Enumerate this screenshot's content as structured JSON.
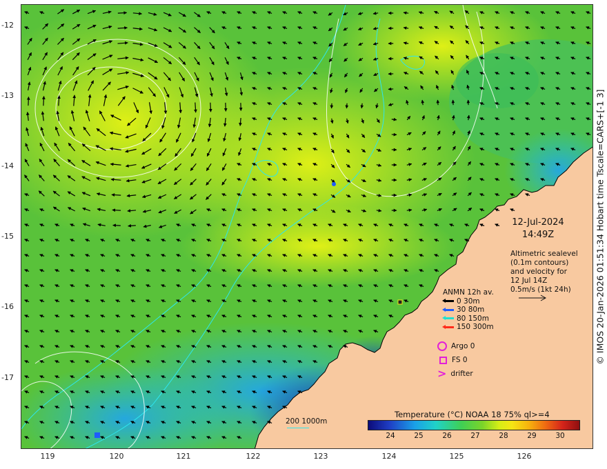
{
  "map": {
    "lat_labels": [
      "-12",
      "-13",
      "-14",
      "-15",
      "-16",
      "-17"
    ],
    "lon_labels": [
      "119",
      "120",
      "121",
      "122",
      "123",
      "124",
      "125",
      "126"
    ],
    "credit": "© IMOS 20-Jan-2026 01:51:34 Hobart time Tscale=CARS+[-1 3]",
    "date": "12-Jul-2024",
    "time": "14:49Z",
    "altimetry_lines": [
      "Altimetric sealevel",
      "(0.1m contours)",
      "and velocity for",
      "12 Jul 14Z",
      "0.5m/s (1kt 24h)"
    ],
    "legend_title": "ANMN 12h av.",
    "legend_items": [
      {
        "label": "0 30m",
        "color": "#000000"
      },
      {
        "label": "30 80m",
        "color": "#1f5cff"
      },
      {
        "label": "80 150m",
        "color": "#20e0d0"
      },
      {
        "label": "150 300m",
        "color": "#ff2a1a"
      }
    ],
    "argo_label": "Argo 0",
    "fs_label": "FS 0",
    "drifter_label": "drifter",
    "depth_contour_label": "200  1000m",
    "colorbar_title": "Temperature (°C) NOAA 18 75% ql>=4",
    "colorbar_ticks": [
      "24",
      "25",
      "26",
      "27",
      "28",
      "29",
      "30"
    ],
    "colors": {
      "land": "#f8c9a0",
      "ocean_warm": "#d6ee16",
      "ocean_mid": "#5fc43a",
      "ocean_cool": "#1aa0e8",
      "ocean_cold": "#1f3ec4",
      "bathymetry": "#2ee6ee",
      "marker": "#e21fd8"
    }
  }
}
